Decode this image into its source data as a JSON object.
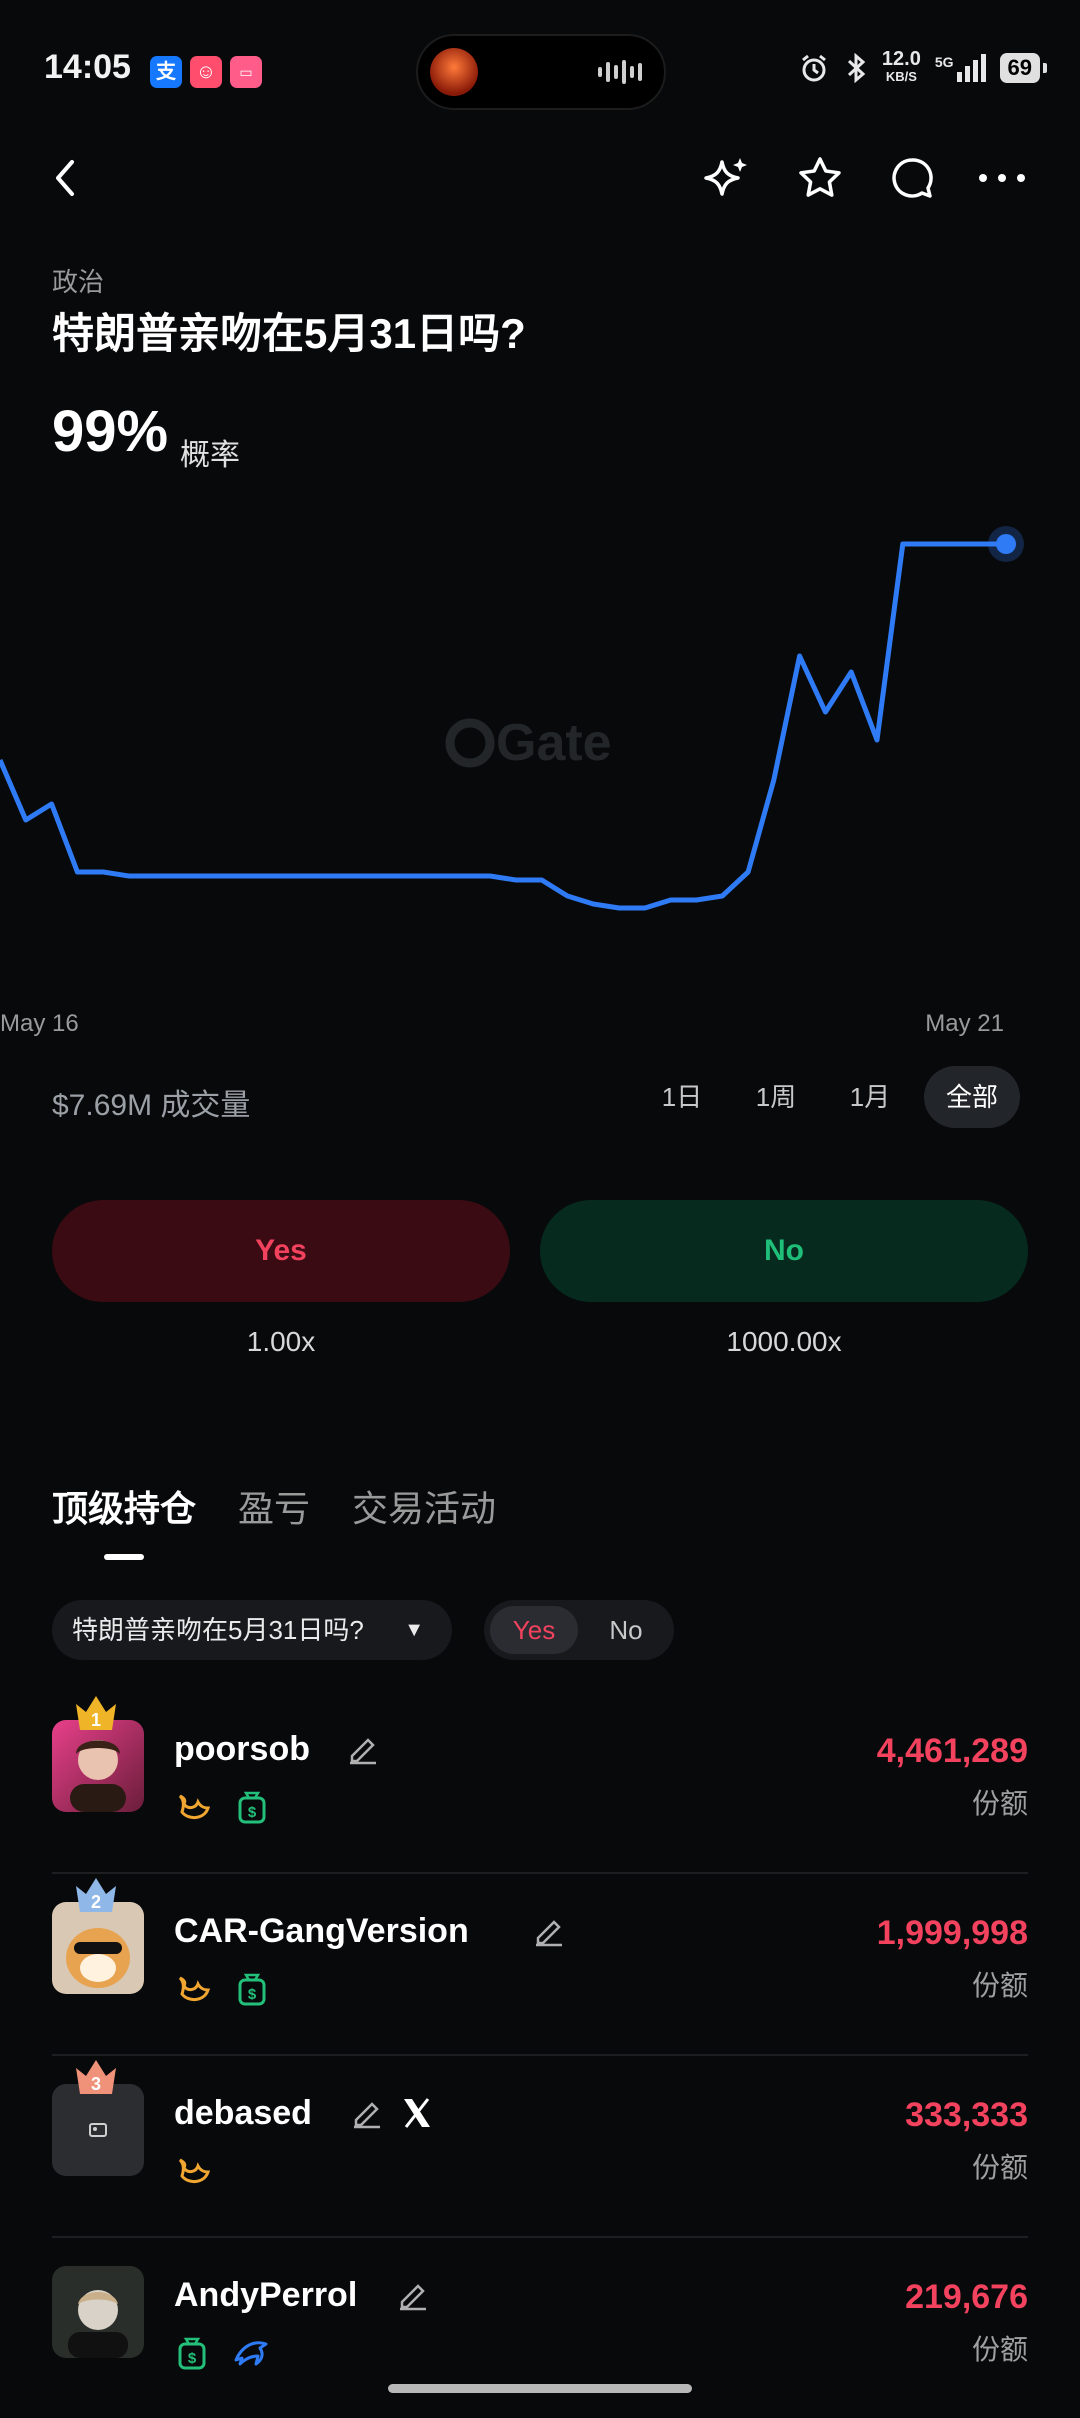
{
  "status_bar": {
    "time": "14:05",
    "net_speed": "12.0",
    "net_unit": "KB/S",
    "signal": "5G",
    "battery": "69"
  },
  "header": {
    "back_icon": "chevron-left-icon",
    "icons": [
      "sparkle-icon",
      "star-icon",
      "comment-icon",
      "more-icon"
    ]
  },
  "market": {
    "category": "政治",
    "title": "特朗普亲吻在5月31日吗?",
    "probability": "99%",
    "probability_label": "概率",
    "watermark": "Gate"
  },
  "chart_data": {
    "type": "line",
    "x_start_label": "May 16",
    "x_end_label": "May 21",
    "series": [
      {
        "color": "#2f7bf5",
        "values": [
          45,
          30,
          34,
          17,
          17,
          16,
          16,
          16,
          16,
          16,
          16,
          16,
          16,
          16,
          16,
          16,
          16,
          16,
          16,
          16,
          15,
          15,
          11,
          9,
          8,
          8,
          10,
          10,
          11,
          17,
          40,
          71,
          57,
          67,
          50,
          99,
          99,
          99,
          99,
          99
        ]
      }
    ],
    "ylim": [
      0,
      100
    ],
    "grid": false
  },
  "volume_text": "$7.69M 成交量",
  "ranges": [
    "1日",
    "1周",
    "1月",
    "全部"
  ],
  "active_range": "全部",
  "trade": {
    "yes_label": "Yes",
    "no_label": "No",
    "yes_multiplier": "1.00x",
    "no_multiplier": "1000.00x"
  },
  "tabs": [
    "顶级持仓",
    "盈亏",
    "交易活动"
  ],
  "filter": {
    "market_select": "特朗普亲吻在5月31日吗?",
    "yes": "Yes",
    "no": "No"
  },
  "holders": [
    {
      "rank": "1",
      "name": "poorsob",
      "shares": "4,461,289",
      "shares_label": "份额",
      "badges": [
        "whale-icon",
        "money-bag-icon"
      ],
      "crown_color": "#f0b429"
    },
    {
      "rank": "2",
      "name": "CAR-GangVersion",
      "shares": "1,999,998",
      "shares_label": "份额",
      "badges": [
        "whale-icon",
        "money-bag-icon"
      ],
      "crown_color": "#8fb8e8"
    },
    {
      "rank": "3",
      "name": "debased",
      "shares": "333,333",
      "shares_label": "份额",
      "badges": [
        "whale-icon"
      ],
      "crown_color": "#f0917a"
    },
    {
      "rank": "",
      "name": "AndyPerrol",
      "shares": "219,676",
      "shares_label": "份额",
      "badges": [
        "money-bag-icon",
        "dolphin-icon"
      ],
      "crown_color": ""
    }
  ],
  "colors": {
    "yes": "#f2425e",
    "no": "#1fbf7a",
    "line": "#2f7bf5",
    "whale": "#f0a630",
    "money": "#22c07a",
    "dolphin": "#2f7bf5"
  }
}
